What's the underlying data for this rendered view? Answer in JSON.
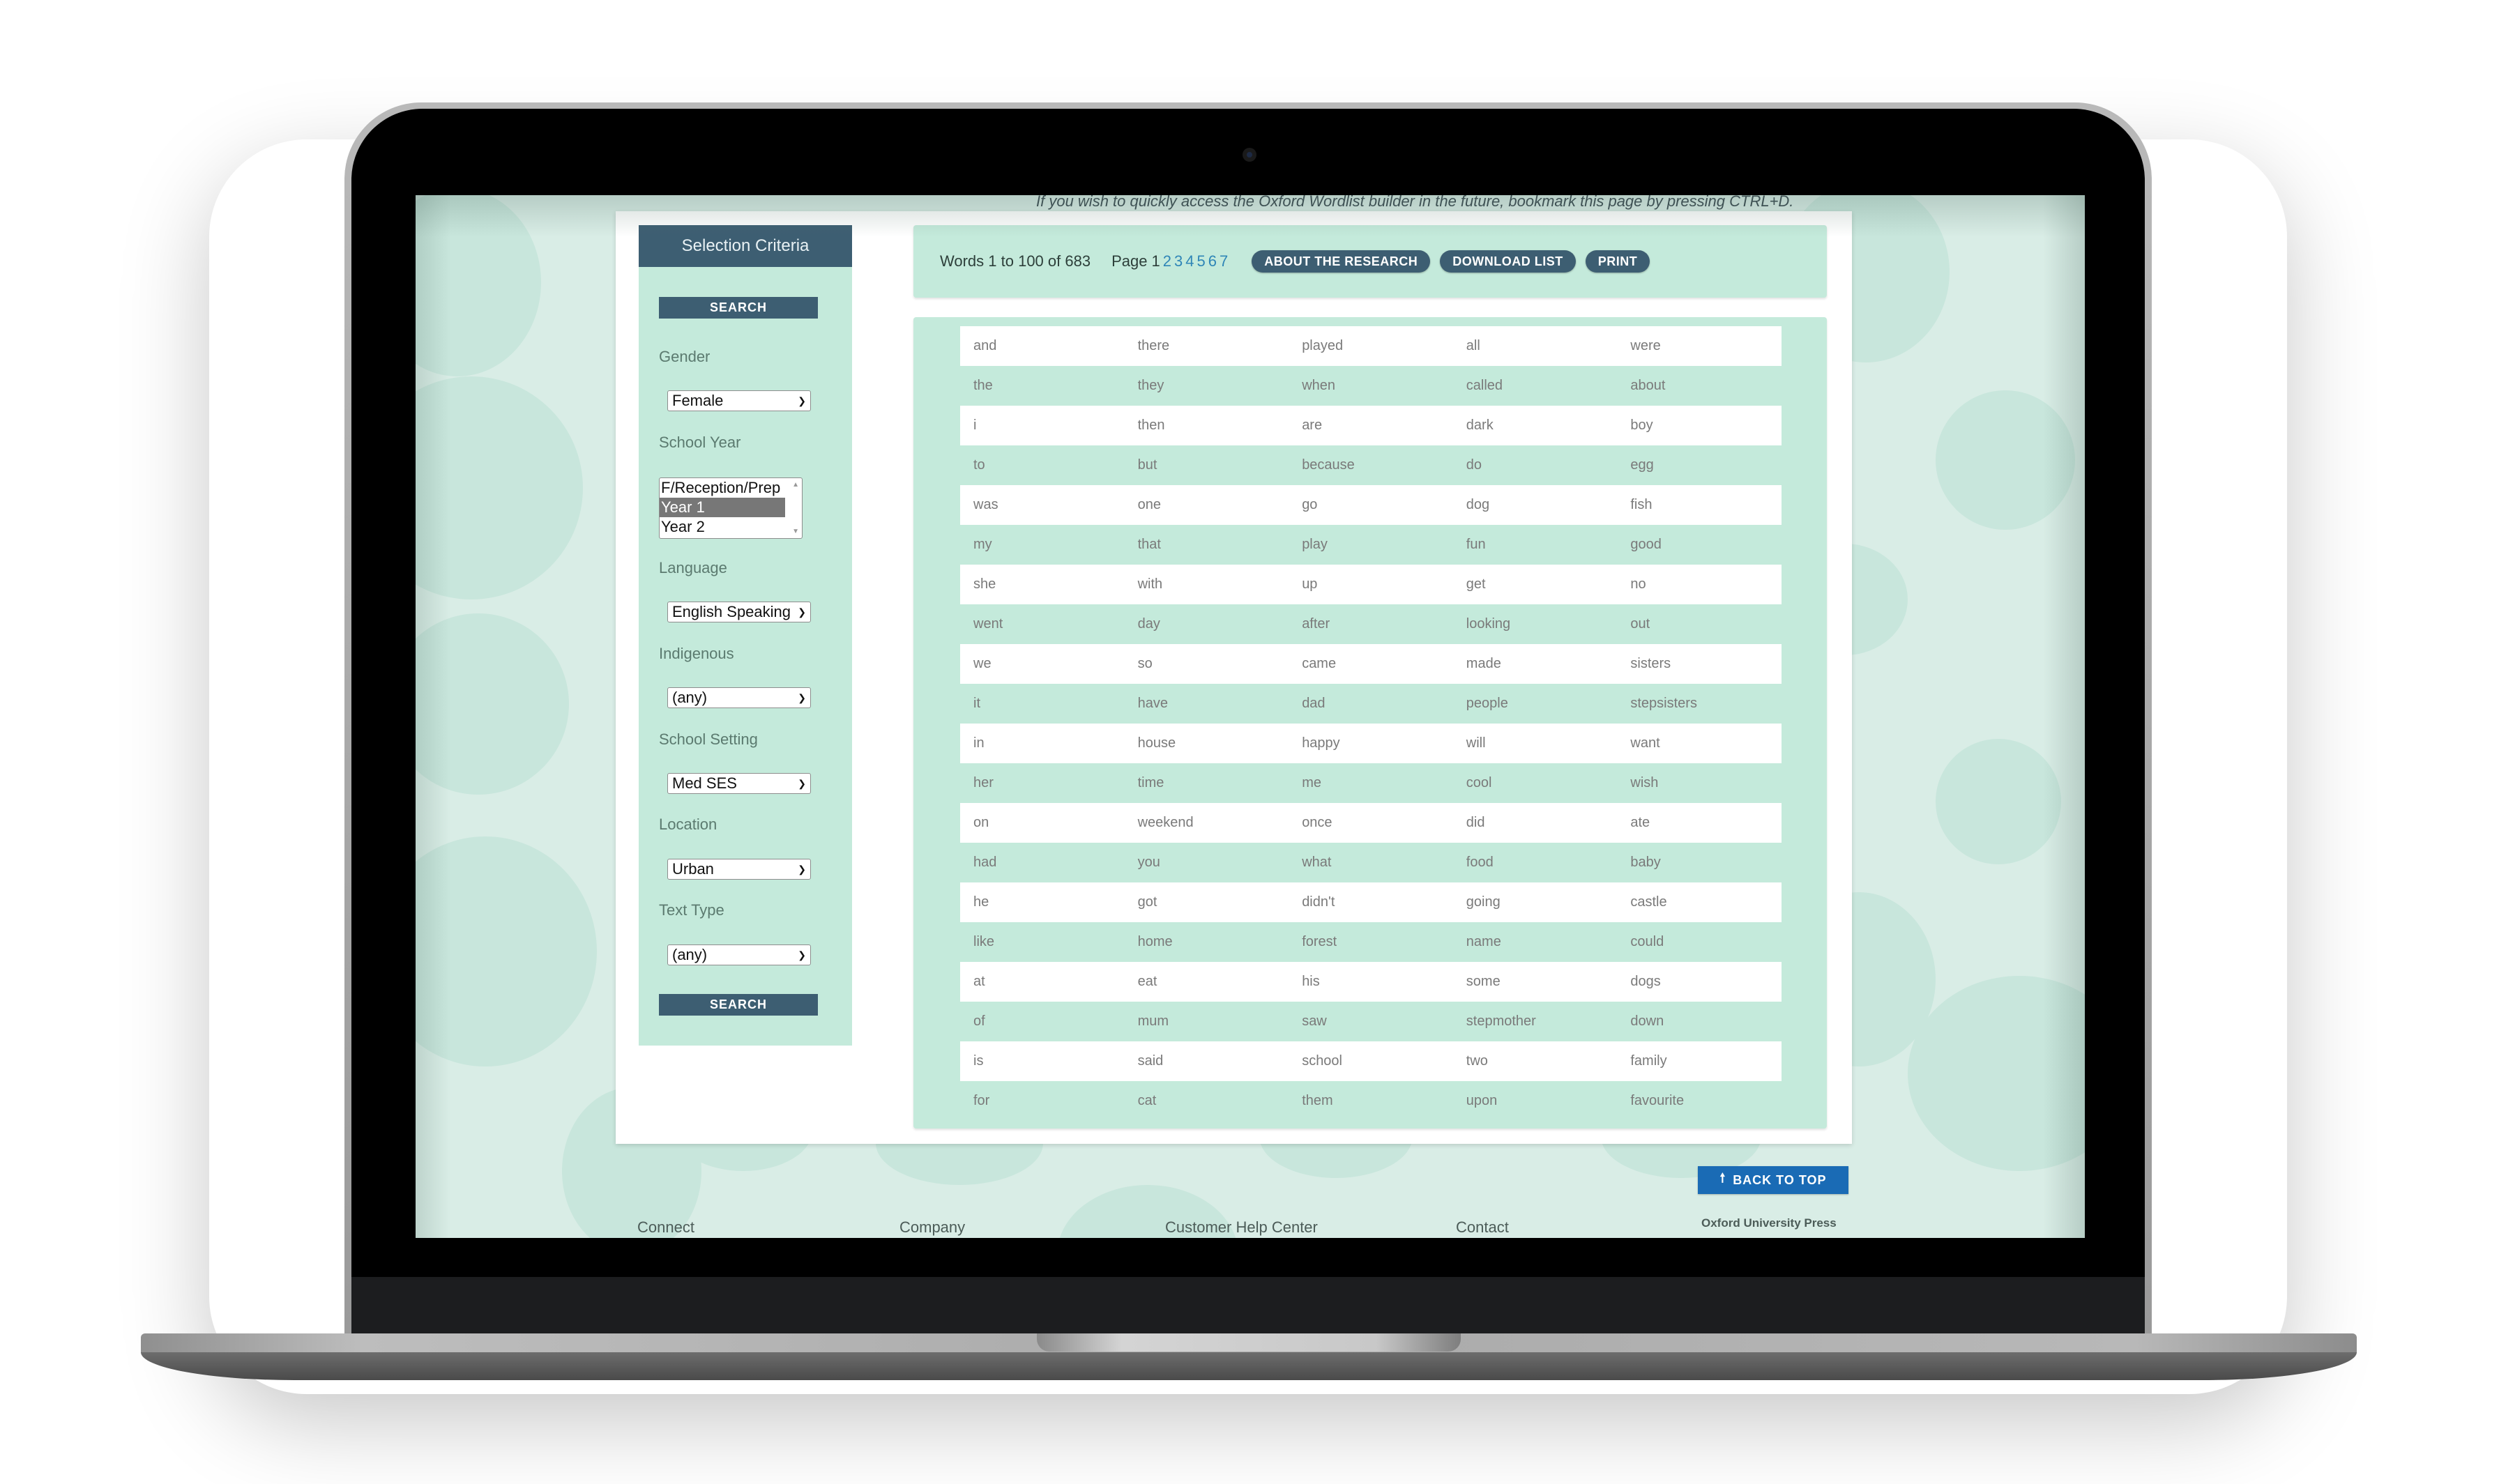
{
  "page": {
    "bookmark_hint": "If you wish to quickly access the Oxford Wordlist builder in the future, bookmark this page by pressing CTRL+D."
  },
  "sidebar": {
    "title": "Selection Criteria",
    "search_label": "SEARCH",
    "fields": [
      {
        "label": "Gender",
        "value": "Female"
      },
      {
        "label": "School Year",
        "options": [
          "F/Reception/Prep",
          "Year 1",
          "Year 2"
        ],
        "selected": "Year 1"
      },
      {
        "label": "Language",
        "value": "English Speaking"
      },
      {
        "label": "Indigenous",
        "value": "(any)"
      },
      {
        "label": "School Setting",
        "value": "Med SES"
      },
      {
        "label": "Location",
        "value": "Urban"
      },
      {
        "label": "Text Type",
        "value": "(any)"
      }
    ]
  },
  "toolbar": {
    "count_text": "Words 1 to 100 of 683",
    "page_label": "Page",
    "pages": [
      "1",
      "2",
      "3",
      "4",
      "5",
      "6",
      "7"
    ],
    "current_page": "1",
    "about_label": "ABOUT THE RESEARCH",
    "download_label": "DOWNLOAD LIST",
    "print_label": "PRINT"
  },
  "words": [
    [
      "and",
      "there",
      "played",
      "all",
      "were"
    ],
    [
      "the",
      "they",
      "when",
      "called",
      "about"
    ],
    [
      "i",
      "then",
      "are",
      "dark",
      "boy"
    ],
    [
      "to",
      "but",
      "because",
      "do",
      "egg"
    ],
    [
      "was",
      "one",
      "go",
      "dog",
      "fish"
    ],
    [
      "my",
      "that",
      "play",
      "fun",
      "good"
    ],
    [
      "she",
      "with",
      "up",
      "get",
      "no"
    ],
    [
      "went",
      "day",
      "after",
      "looking",
      "out"
    ],
    [
      "we",
      "so",
      "came",
      "made",
      "sisters"
    ],
    [
      "it",
      "have",
      "dad",
      "people",
      "stepsisters"
    ],
    [
      "in",
      "house",
      "happy",
      "will",
      "want"
    ],
    [
      "her",
      "time",
      "me",
      "cool",
      "wish"
    ],
    [
      "on",
      "weekend",
      "once",
      "did",
      "ate"
    ],
    [
      "had",
      "you",
      "what",
      "food",
      "baby"
    ],
    [
      "he",
      "got",
      "didn't",
      "going",
      "castle"
    ],
    [
      "like",
      "home",
      "forest",
      "name",
      "could"
    ],
    [
      "at",
      "eat",
      "his",
      "some",
      "dogs"
    ],
    [
      "of",
      "mum",
      "saw",
      "stepmother",
      "down"
    ],
    [
      "is",
      "said",
      "school",
      "two",
      "family"
    ],
    [
      "for",
      "cat",
      "them",
      "upon",
      "favourite"
    ]
  ],
  "footer": {
    "back_to_top": "BACK TO TOP",
    "links": [
      "Connect",
      "Company",
      "Customer Help Center",
      "Contact"
    ],
    "publisher": "Oxford University Press"
  },
  "colors": {
    "accent_dark": "#3d5e72",
    "panel_mint": "#c4eadb",
    "link_blue": "#2f86b7",
    "back_to_top_blue": "#1a6bb5"
  }
}
